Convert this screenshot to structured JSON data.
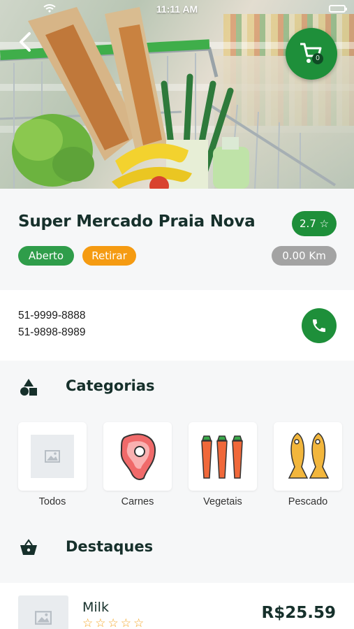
{
  "status_bar": {
    "time": "11:11 AM"
  },
  "header": {
    "cart_count": "0"
  },
  "store": {
    "name": "Super Mercado Praia Nova",
    "rating": "2.7 ☆",
    "status": "Aberto",
    "delivery_mode": "Retirar",
    "distance": "0.00 Km"
  },
  "contact": {
    "phones": [
      "51-9999-8888",
      "51-9898-8989"
    ]
  },
  "categories": {
    "title": "Categorias",
    "items": [
      {
        "label": "Todos",
        "icon": "image-placeholder-icon"
      },
      {
        "label": "Carnes",
        "icon": "steak-icon"
      },
      {
        "label": "Vegetais",
        "icon": "carrots-icon"
      },
      {
        "label": "Pescado",
        "icon": "fish-icon"
      }
    ]
  },
  "featured": {
    "title": "Destaques",
    "items": [
      {
        "name": "Milk",
        "rating_stars": "☆☆☆☆☆",
        "price": "R$25.59"
      }
    ]
  },
  "colors": {
    "primary": "#1e8f3a",
    "open": "#2f9d4a",
    "pickup": "#f59b12",
    "distance": "#a3a3a3",
    "title": "#16302b"
  }
}
